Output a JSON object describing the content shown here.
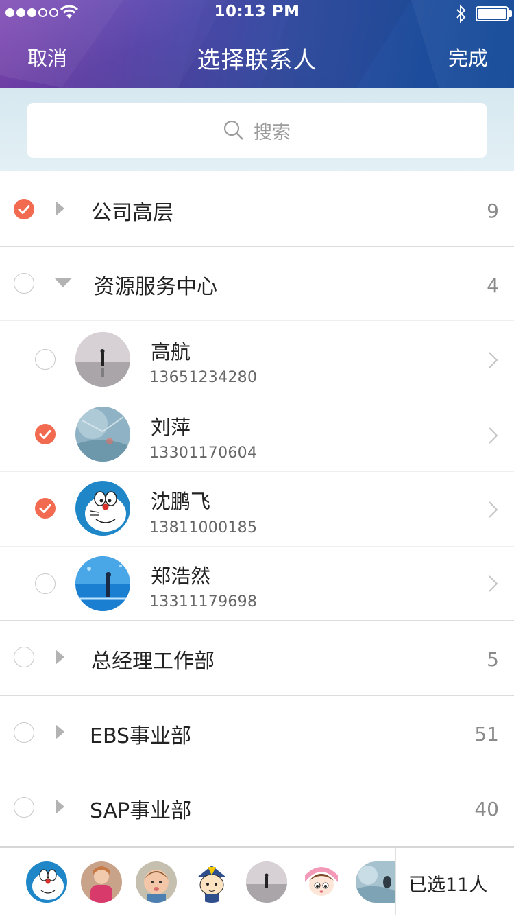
{
  "status_bar": {
    "time": "10:13 PM"
  },
  "nav": {
    "cancel": "取消",
    "title": "选择联系人",
    "done": "完成"
  },
  "search": {
    "placeholder": "搜索"
  },
  "groups": [
    {
      "name": "公司高层",
      "count": "9",
      "checked": true,
      "expanded": false
    },
    {
      "name": "资源服务中心",
      "count": "4",
      "checked": false,
      "expanded": true
    },
    {
      "name": "总经理工作部",
      "count": "5",
      "checked": false,
      "expanded": false
    },
    {
      "name": "EBS事业部",
      "count": "51",
      "checked": false,
      "expanded": false
    },
    {
      "name": "SAP事业部",
      "count": "40",
      "checked": false,
      "expanded": false
    }
  ],
  "members": [
    {
      "name": "高航",
      "phone": "13651234280",
      "checked": false,
      "avatar": "person-on-beach-avatar"
    },
    {
      "name": "刘萍",
      "phone": "13301170604",
      "checked": true,
      "avatar": "underwater-avatar"
    },
    {
      "name": "沈鹏飞",
      "phone": "13811000185",
      "checked": true,
      "avatar": "doraemon-avatar"
    },
    {
      "name": "郑浩然",
      "phone": "13311179698",
      "checked": false,
      "avatar": "aquarium-avatar"
    }
  ],
  "selected": {
    "label": "已选11人"
  },
  "colors": {
    "accent": "#f26a4f",
    "header_start": "#7b3fb6",
    "header_end": "#0f4796"
  }
}
